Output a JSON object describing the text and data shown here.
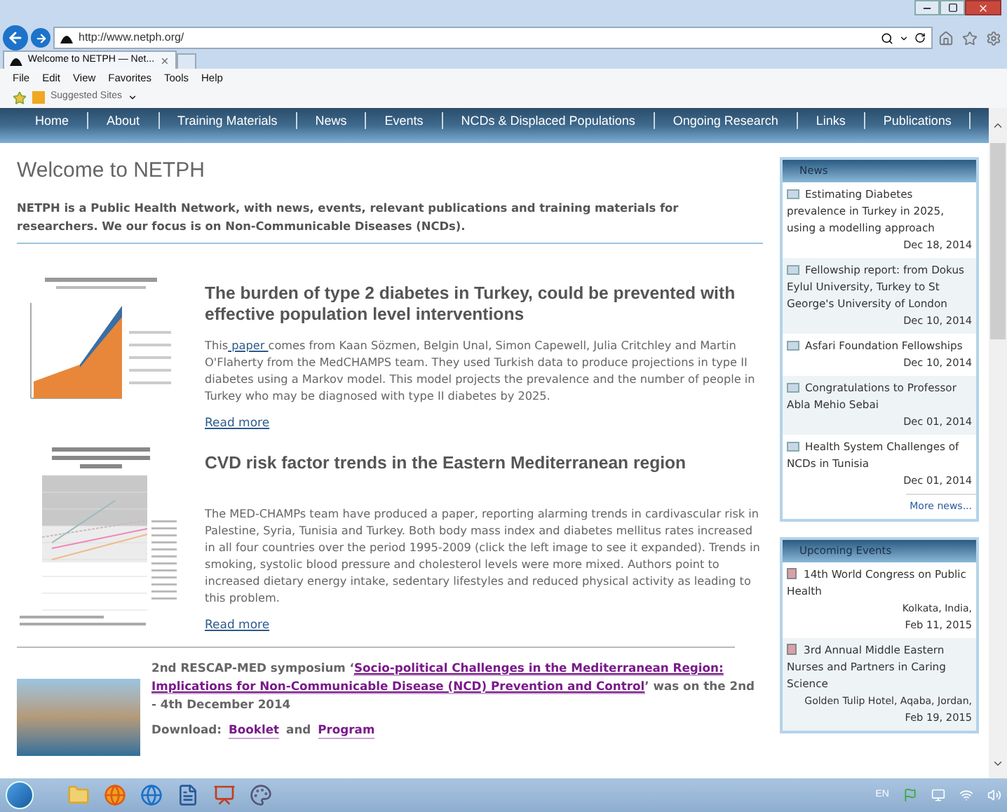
{
  "browser": {
    "url": "http://www.netph.org/",
    "tab_title": "Welcome to NETPH — Net...",
    "menu": [
      "File",
      "Edit",
      "View",
      "Favorites",
      "Tools",
      "Help"
    ],
    "favorite": "Suggested Sites"
  },
  "nav": [
    "Home",
    "About",
    "Training Materials",
    "News",
    "Events",
    "NCDs & Displaced Populations",
    "Ongoing Research",
    "Links",
    "Publications"
  ],
  "page": {
    "title": "Welcome to NETPH",
    "intro": "NETPH is a Public Health Network, with news, events, relevant publications and training materials for researchers. We our focus is on Non-Communicable Diseases (NCDs).",
    "articles": [
      {
        "kind": "area_chart",
        "title": "The burden of type 2 diabetes in Turkey, could be prevented with effective population level interventions",
        "body": [
          {
            "kind": "text",
            "text": "This"
          },
          {
            "kind": "link",
            "text": " paper "
          },
          {
            "kind": "text",
            "text": "comes from Kaan Sözmen, Belgin Unal, Simon Capewell, Julia Critchley and Martin O'Flaherty from the MedCHAMPS team. They used Turkish data to produce projections in type II diabetes using a Markov model.  This model projects the prevalence and the number of people in Turkey who may be diagnosed with type II diabetes by 2025."
          }
        ],
        "read_more": "Read more"
      },
      {
        "kind": "line_chart",
        "title": "CVD risk factor trends in the Eastern Mediterranean region",
        "body": [
          {
            "kind": "text",
            "text": "The MED-CHAMPs team have produced a paper, reporting alarming trends in cardivascular risk in Palestine, Syria, Tunisia and Turkey. Both body mass index and diabetes mellitus rates increased in all four countries over the period 1995-2009 (click the left image to see it expanded). Trends in smoking, systolic blood pressure and cholesterol levels were more mixed. Authors point to increased dietary energy intake, sedentary lifestyles and reduced physical activity as leading to this problem."
          }
        ],
        "read_more": "Read more "
      }
    ],
    "event_post": {
      "body": [
        {
          "kind": "text",
          "text": "2nd RESCAP-MED symposium ‘"
        },
        {
          "kind": "link",
          "text": "Socio-political Challenges in the Mediterranean Region:"
        },
        {
          "kind": "link",
          "text": "Implications for Non-Communicable Disease (NCD) Prevention and Control"
        },
        {
          "kind": "text",
          "text": "’ was on the 2nd - 4th December 2014"
        }
      ],
      "download_label": "Download:",
      "downloads": [
        "Booklet",
        "Program"
      ],
      "joiner": "and"
    }
  },
  "sidebar": {
    "news": {
      "title": "News",
      "items": [
        {
          "title": "Estimating Diabetes prevalence in Turkey in 2025, using a modelling approach",
          "date": "Dec 18, 2014"
        },
        {
          "title": "Fellowship report: from Dokus Eylul University, Turkey to St George's University of London",
          "date": "Dec 10, 2014"
        },
        {
          "title": "Asfari Foundation Fellowships",
          "date": "Dec 10, 2014"
        },
        {
          "title": "Congratulations to Professor Abla Mehio Sebai",
          "date": "Dec 01, 2014"
        },
        {
          "title": "Health System Challenges of NCDs in Tunisia",
          "date": "Dec 01, 2014"
        }
      ],
      "more": "More news..."
    },
    "events": {
      "title": "Upcoming Events",
      "items": [
        {
          "title": "14th World Congress on Public Health",
          "location": "Kolkata, India,",
          "date": "Feb 11, 2015"
        },
        {
          "title": "3rd Annual Middle Eastern Nurses and Partners in Caring Science",
          "location": "Golden Tulip Hotel, Aqaba, Jordan,",
          "date": "Feb 19, 2015"
        }
      ]
    }
  },
  "taskbar": {
    "language": "EN"
  }
}
